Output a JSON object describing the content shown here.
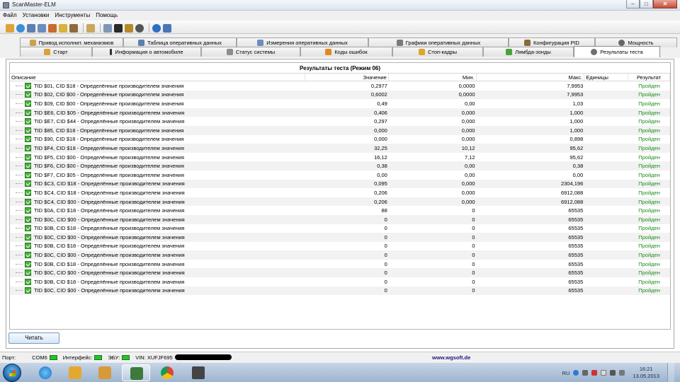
{
  "window": {
    "title": "ScanMaster-ELM",
    "minimize": "–",
    "maximize": "□",
    "close": "✕"
  },
  "menu": [
    "Файл",
    "Установки",
    "Инструменты",
    "Помощь"
  ],
  "toolbar_icons": [
    "connect-icon",
    "globe-icon",
    "table-icon",
    "grid-icon",
    "chart-icon",
    "battery-icon",
    "user-icon",
    "clipboard-icon",
    "monitor-icon",
    "terminal-icon",
    "gauge-icon",
    "palette-icon",
    "info-icon",
    "book-icon"
  ],
  "tabs_row1": [
    {
      "label": "Привод исполнит. механизмов",
      "icon": "actuator-icon"
    },
    {
      "label": "Таблица оперативных данных",
      "icon": "table-icon"
    },
    {
      "label": "Измерения оперативных данных",
      "icon": "grid-icon"
    },
    {
      "label": "Графики оперативных данных",
      "icon": "graph-icon"
    },
    {
      "label": "Конфигурация PID",
      "icon": "config-icon"
    },
    {
      "label": "Мощность",
      "icon": "power-icon"
    }
  ],
  "tabs_row2": [
    {
      "label": "Старт",
      "icon": "home-icon"
    },
    {
      "label": "Информация о автомобиле",
      "icon": "info-icon"
    },
    {
      "label": "Статус системы",
      "icon": "status-icon"
    },
    {
      "label": "Коды ошибок",
      "icon": "warning-icon"
    },
    {
      "label": "Стоп-кадры",
      "icon": "freeze-frame-icon"
    },
    {
      "label": "Лямбда-зонды",
      "icon": "lambda-icon"
    },
    {
      "label": "Результаты теста",
      "icon": "test-icon",
      "active": true
    }
  ],
  "grid": {
    "title": "Результаты теста (Режим 06)",
    "columns": [
      "Описание",
      "Значение",
      "Мин.",
      "Макс.",
      "Единицы",
      "Результат"
    ],
    "rows": [
      {
        "desc": "TID $01, CID $18 - Определённые производителем значения",
        "value": "0,2977",
        "min": "0,0000",
        "max": "7,9953",
        "unit": "",
        "result": "Пройден"
      },
      {
        "desc": "TID $02, CID $00 - Определённые производителем значения",
        "value": "0,6002",
        "min": "0,0000",
        "max": "7,9953",
        "unit": "",
        "result": "Пройден"
      },
      {
        "desc": "TID $09, CID $00 - Определённые производителем значения",
        "value": "0,49",
        "min": "0,00",
        "max": "1,03",
        "unit": "",
        "result": "Пройден"
      },
      {
        "desc": "TID $E6, CID $05 - Определённые производителем значения",
        "value": "0,406",
        "min": "0,000",
        "max": "1,000",
        "unit": "",
        "result": "Пройден"
      },
      {
        "desc": "TID $E7, CID $44 - Определённые производителем значения",
        "value": "0,297",
        "min": "0,000",
        "max": "1,000",
        "unit": "",
        "result": "Пройден"
      },
      {
        "desc": "TID $85, CID $18 - Определённые производителем значения",
        "value": "0,000",
        "min": "0,000",
        "max": "1,000",
        "unit": "",
        "result": "Пройден"
      },
      {
        "desc": "TID $90, CID $18 - Определённые производителем значения",
        "value": "0,000",
        "min": "0,000",
        "max": "0,898",
        "unit": "",
        "result": "Пройден"
      },
      {
        "desc": "TID $F4, CID $18 - Определённые производителем значения",
        "value": "32,25",
        "min": "10,12",
        "max": "95,62",
        "unit": "",
        "result": "Пройден"
      },
      {
        "desc": "TID $F5, CID $00 - Определённые производителем значения",
        "value": "16,12",
        "min": "7,12",
        "max": "95,62",
        "unit": "",
        "result": "Пройден"
      },
      {
        "desc": "TID $F6, CID $00 - Определённые производителем значения",
        "value": "0,38",
        "min": "0,00",
        "max": "0,38",
        "unit": "",
        "result": "Пройден"
      },
      {
        "desc": "TID $F7, CID $05 - Определённые производителем значения",
        "value": "0,00",
        "min": "0,00",
        "max": "0,00",
        "unit": "",
        "result": "Пройден"
      },
      {
        "desc": "TID $C3, CID $18 - Определённые производителем значения",
        "value": "0,095",
        "min": "0,000",
        "max": "2304,196",
        "unit": "",
        "result": "Пройден"
      },
      {
        "desc": "TID $C4, CID $18 - Определённые производителем значения",
        "value": "0,206",
        "min": "0,000",
        "max": "6912,088",
        "unit": "",
        "result": "Пройден"
      },
      {
        "desc": "TID $C4, CID $00 - Определённые производителем значения",
        "value": "0,206",
        "min": "0,000",
        "max": "6912,088",
        "unit": "",
        "result": "Пройден"
      },
      {
        "desc": "TID $0A, CID $18 - Определённые производителем значения",
        "value": "88",
        "min": "0",
        "max": "65535",
        "unit": "",
        "result": "Пройден"
      },
      {
        "desc": "TID $0C, CID $00 - Определённые производителем значения",
        "value": "0",
        "min": "0",
        "max": "65535",
        "unit": "",
        "result": "Пройден"
      },
      {
        "desc": "TID $0B, CID $18 - Определённые производителем значения",
        "value": "0",
        "min": "0",
        "max": "65535",
        "unit": "",
        "result": "Пройден"
      },
      {
        "desc": "TID $0C, CID $00 - Определённые производителем значения",
        "value": "0",
        "min": "0",
        "max": "65535",
        "unit": "",
        "result": "Пройден"
      },
      {
        "desc": "TID $0B, CID $18 - Определённые производителем значения",
        "value": "0",
        "min": "0",
        "max": "65535",
        "unit": "",
        "result": "Пройден"
      },
      {
        "desc": "TID $0C, CID $00 - Определённые производителем значения",
        "value": "0",
        "min": "0",
        "max": "65535",
        "unit": "",
        "result": "Пройден"
      },
      {
        "desc": "TID $0B, CID $18 - Определённые производителем значения",
        "value": "0",
        "min": "0",
        "max": "65535",
        "unit": "",
        "result": "Пройден"
      },
      {
        "desc": "TID $0C, CID $00 - Определённые производителем значения",
        "value": "0",
        "min": "0",
        "max": "65535",
        "unit": "",
        "result": "Пройден"
      },
      {
        "desc": "TID $0B, CID $18 - Определённые производителем значения",
        "value": "0",
        "min": "0",
        "max": "65535",
        "unit": "",
        "result": "Пройден"
      },
      {
        "desc": "TID $0C, CID $00 - Определённые производителем значения",
        "value": "0",
        "min": "0",
        "max": "65535",
        "unit": "",
        "result": "Пройден"
      }
    ]
  },
  "read_button": "Читать",
  "statusbar": {
    "port_label": "Порт:",
    "port_value": "COM6",
    "interface_label": "Интерфейс:",
    "ecu_label": "ЭБУ:",
    "vin_label": "VIN: XUFJF695",
    "website": "www.wgsoft.de"
  },
  "taskbar": {
    "lang": "RU",
    "time": "16:21",
    "date": "13.05.2013"
  },
  "colors": {
    "pass": "#1b8f1b",
    "led": "#27c227",
    "accent": "#1d5fa8"
  }
}
